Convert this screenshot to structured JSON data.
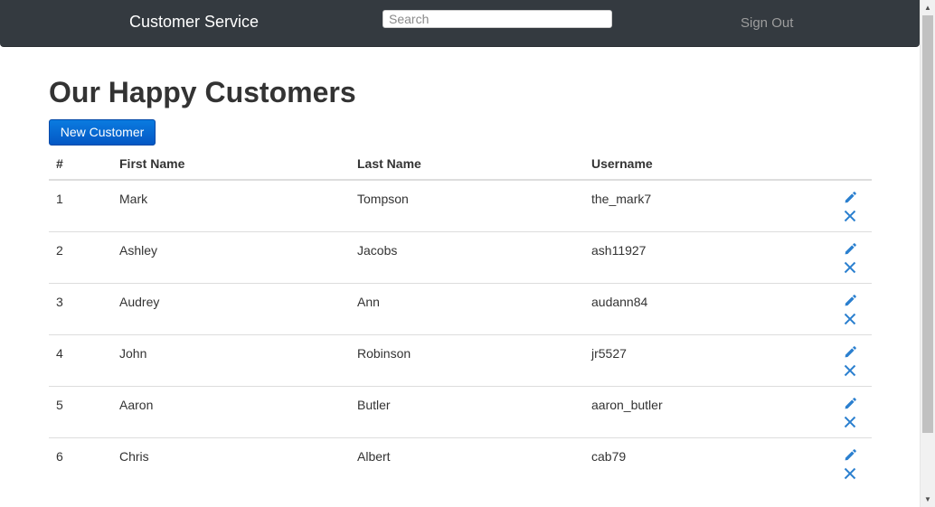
{
  "navbar": {
    "brand": "Customer Service",
    "search_placeholder": "Search",
    "search_value": "",
    "signout_label": "Sign Out"
  },
  "page": {
    "title": "Our Happy Customers",
    "new_button_label": "New Customer"
  },
  "table": {
    "headers": [
      "#",
      "First Name",
      "Last Name",
      "Username"
    ],
    "rows": [
      {
        "num": "1",
        "first": "Mark",
        "last": "Tompson",
        "username": "the_mark7"
      },
      {
        "num": "2",
        "first": "Ashley",
        "last": "Jacobs",
        "username": "ash11927"
      },
      {
        "num": "3",
        "first": "Audrey",
        "last": "Ann",
        "username": "audann84"
      },
      {
        "num": "4",
        "first": "John",
        "last": "Robinson",
        "username": "jr5527"
      },
      {
        "num": "5",
        "first": "Aaron",
        "last": "Butler",
        "username": "aaron_butler"
      },
      {
        "num": "6",
        "first": "Chris",
        "last": "Albert",
        "username": "cab79"
      }
    ],
    "row_actions": {
      "edit_icon": "pencil-icon",
      "delete_icon": "remove-icon"
    }
  },
  "colors": {
    "navbar_bg": "#343a40",
    "primary_button": "#0a6fd8",
    "icon_blue": "#2a7fcf"
  }
}
